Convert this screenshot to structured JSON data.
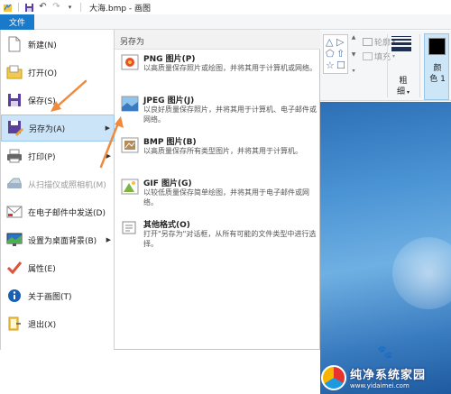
{
  "titlebar": {
    "title": "大海.bmp - 画图",
    "icons": [
      "paint-app-icon",
      "save-icon",
      "undo-icon",
      "redo-icon",
      "customize-quick-access-icon"
    ]
  },
  "ribbon": {
    "file_tab_label": "文件",
    "outline_label": "轮廓",
    "fill_label": "填充",
    "thickness_label": "粗\n细",
    "thickness_line1": "粗",
    "thickness_line2": "细",
    "color1_line1": "颜",
    "color1_line2": "色 1",
    "color1_value": "#000000"
  },
  "file_menu": {
    "items": [
      {
        "label": "新建(N)",
        "icon": "new-file-icon"
      },
      {
        "label": "打开(O)",
        "icon": "open-folder-icon"
      },
      {
        "label": "保存(S)",
        "icon": "save-icon"
      },
      {
        "label": "另存为(A)",
        "icon": "save-as-icon",
        "active": true,
        "submenu": true
      },
      {
        "label": "打印(P)",
        "icon": "printer-icon",
        "submenu": true
      },
      {
        "label": "从扫描仪或照相机(M)",
        "icon": "scanner-icon",
        "disabled": true
      },
      {
        "label": "在电子邮件中发送(D)",
        "icon": "email-icon"
      },
      {
        "label": "设置为桌面背景(B)",
        "icon": "desktop-background-icon",
        "submenu": true
      },
      {
        "label": "属性(E)",
        "icon": "properties-check-icon"
      },
      {
        "label": "关于画图(T)",
        "icon": "info-icon"
      },
      {
        "label": "退出(X)",
        "icon": "exit-icon"
      }
    ]
  },
  "submenu": {
    "title": "另存为",
    "items": [
      {
        "name": "PNG 图片(P)",
        "desc": "以高质量保存照片或绘图，并将其用于计算机或网络。",
        "icon": "png-image-icon"
      },
      {
        "name": "JPEG 图片(J)",
        "desc": "以良好质量保存照片，并将其用于计算机、电子邮件或网络。",
        "icon": "jpeg-image-icon"
      },
      {
        "name": "BMP 图片(B)",
        "desc": "以高质量保存所有类型图片，并将其用于计算机。",
        "icon": "bmp-image-icon"
      },
      {
        "name": "GIF 图片(G)",
        "desc": "以较低质量保存简单绘图，并将其用于电子邮件或网络。",
        "icon": "gif-image-icon"
      },
      {
        "name": "其他格式(O)",
        "desc": "打开\"另存为\"对话框，从所有可能的文件类型中进行选择。",
        "icon": "other-formats-icon"
      }
    ]
  },
  "watermark": {
    "name": "纯净系统家园",
    "url": "www.yidaimei.com"
  },
  "colors": {
    "file_tab": "#1979ca",
    "menu_active": "#cce4f7",
    "annotation_arrow": "#f08a3c"
  }
}
